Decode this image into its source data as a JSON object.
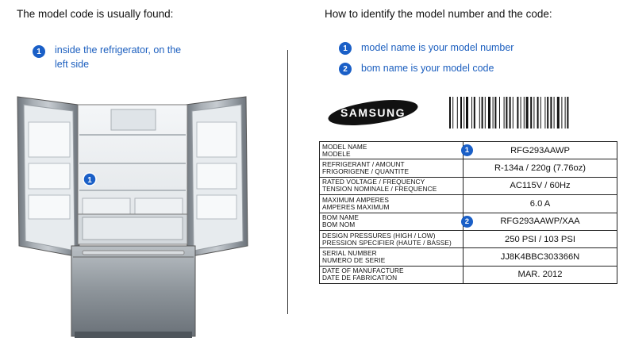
{
  "left": {
    "heading": "The model code is usually found:",
    "step1_number": "1",
    "step1_text_line1": "inside the refrigerator, on the",
    "step1_text_line2": "left side",
    "fridge_marker": "1"
  },
  "right": {
    "heading": "How to identify the model number and the code:",
    "steps": [
      {
        "number": "1",
        "text": "model name is your model number"
      },
      {
        "number": "2",
        "text": "bom name is your model code"
      }
    ],
    "brand": "SAMSUNG",
    "label_rows": [
      {
        "name1": "MODEL NAME",
        "name2": "MODELE",
        "value": "RFG293AAWP",
        "badge": "1"
      },
      {
        "name1": "REFRIGERANT / AMOUNT",
        "name2": "FRIGORIGENE / QUANTITE",
        "value": "R-134a / 220g (7.76oz)",
        "badge": ""
      },
      {
        "name1": "RATED VOLTAGE / FREQUENCY",
        "name2": "TENSION NOMINALE / FREQUENCE",
        "value": "AC115V / 60Hz",
        "badge": ""
      },
      {
        "name1": "MAXIMUM AMPERES",
        "name2": "AMPERES MAXIMUM",
        "value": "6.0 A",
        "badge": ""
      },
      {
        "name1": "BOM NAME",
        "name2": "BOM NOM",
        "value": "RFG293AAWP/XAA",
        "badge": "2"
      },
      {
        "name1": "DESIGN PRESSURES (HIGH / LOW)",
        "name2": "PRESSION SPECIFIER (HAUTE / BASSE)",
        "value": "250 PSI / 103 PSI",
        "badge": ""
      },
      {
        "name1": "SERIAL NUMBER",
        "name2": "NUMERO DE SERIE",
        "value": "JJ8K4BBC303366N",
        "badge": ""
      },
      {
        "name1": "DATE OF MANUFACTURE",
        "name2": "DATE DE FABRICATION",
        "value": "MAR. 2012",
        "badge": ""
      }
    ]
  },
  "colors": {
    "badge_blue": "#1a5fc7",
    "text_blue": "#1c5fbf",
    "stainless": "#8a9198"
  }
}
